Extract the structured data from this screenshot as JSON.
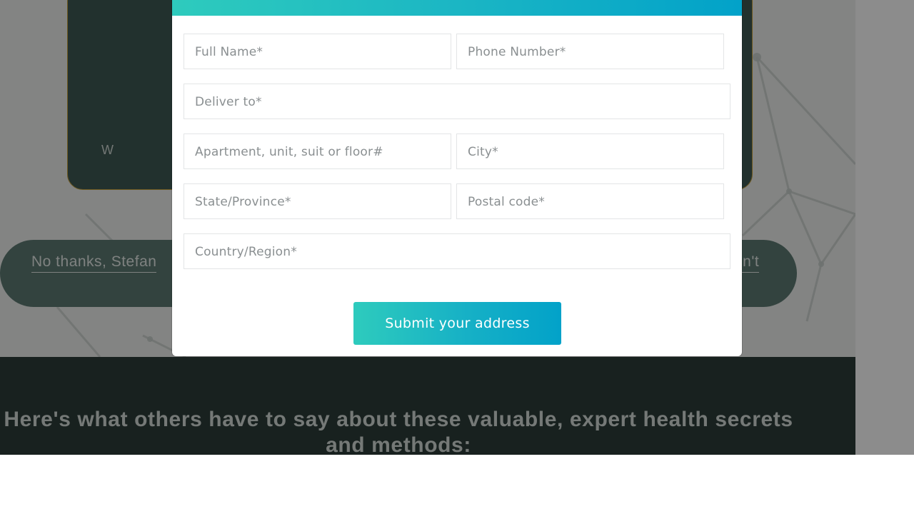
{
  "background": {
    "offer_card_partial_text": "W",
    "decline_link_label": "No thanks, Stefan",
    "decline_link_tail": "on't",
    "testimonial_heading": "Here's what others have to say about these valuable, expert health secrets and methods:"
  },
  "modal": {
    "fields": {
      "full_name_placeholder": "Full Name*",
      "phone_placeholder": "Phone Number*",
      "deliver_to_placeholder": "Deliver to*",
      "apartment_placeholder": "Apartment, unit, suit or floor#",
      "city_placeholder": "City*",
      "state_placeholder": "State/Province*",
      "postal_placeholder": "Postal code*",
      "country_placeholder": "Country/Region*"
    },
    "submit_label": "Submit your address"
  },
  "colors": {
    "accent_start": "#2ecbbd",
    "accent_end": "#02a2c9",
    "dark_section": "#2c3c3a",
    "card": "#3e5a55",
    "card_border": "#c9a23a"
  }
}
